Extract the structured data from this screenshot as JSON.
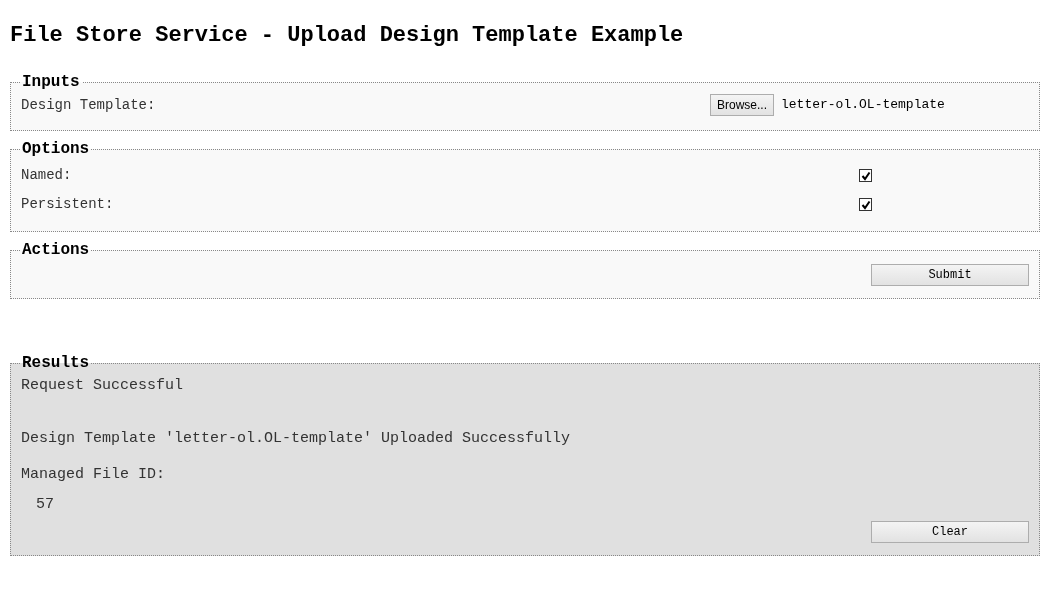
{
  "title": "File Store Service - Upload Design Template Example",
  "inputs": {
    "legend": "Inputs",
    "label": "Design Template:",
    "browse": "Browse...",
    "file_name": "letter-ol.OL-template"
  },
  "options": {
    "legend": "Options",
    "items": [
      {
        "label": "Named:",
        "checked": true
      },
      {
        "label": "Persistent:",
        "checked": true
      }
    ]
  },
  "actions": {
    "legend": "Actions",
    "button": "Submit"
  },
  "results": {
    "legend": "Results",
    "status": "Request Successful",
    "message": "Design Template 'letter-ol.OL-template' Uploaded Successfully",
    "id_label": "Managed File ID:",
    "id_value": "57",
    "button": "Clear"
  }
}
